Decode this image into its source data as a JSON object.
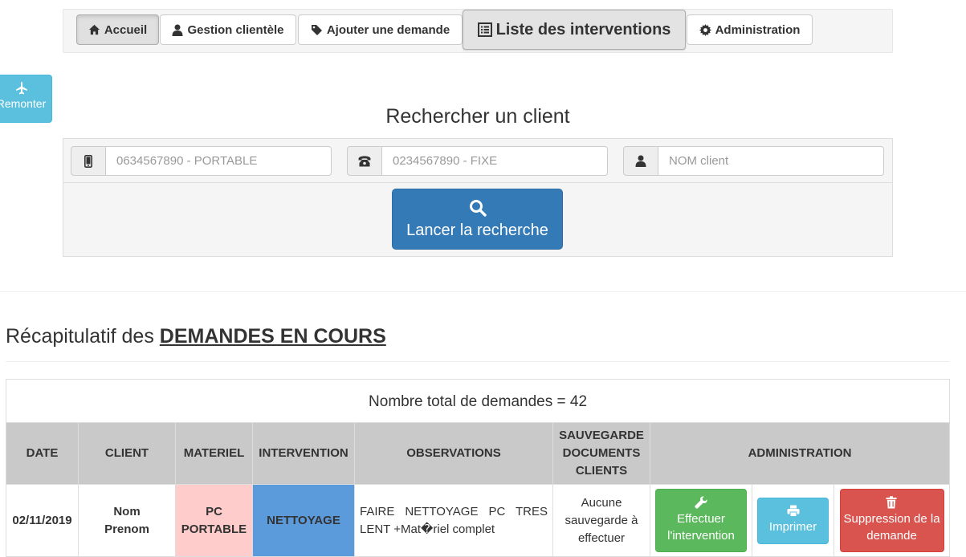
{
  "nav": {
    "items": [
      {
        "label": "Accueil",
        "icon": "home-icon"
      },
      {
        "label": "Gestion clientèle",
        "icon": "user-icon"
      },
      {
        "label": "Ajouter une demande",
        "icon": "tag-icon"
      },
      {
        "label": "Liste des interventions",
        "icon": "list-icon"
      },
      {
        "label": "Administration",
        "icon": "gear-icon"
      }
    ]
  },
  "remonter": {
    "label": "Remonter",
    "icon": "plane-icon"
  },
  "search": {
    "title": "Rechercher un client",
    "mobile_placeholder": "0634567890 - PORTABLE",
    "phone_placeholder": "0234567890 - FIXE",
    "name_placeholder": "NOM client",
    "button_label": "Lancer la recherche"
  },
  "recap": {
    "title_prefix": "Récapitulatif des ",
    "title_emphasis": "DEMANDES EN COURS"
  },
  "table": {
    "total_label": "Nombre total de demandes = 42",
    "headers": {
      "date": "DATE",
      "client": "CLIENT",
      "materiel": "MATERIEL",
      "intervention": "INTERVENTION",
      "observations": "OBSERVATIONS",
      "sauvegarde": "SAUVEGARDE DOCUMENTS CLIENTS",
      "administration": "ADMINISTRATION"
    },
    "rows": [
      {
        "date": "02/11/2019",
        "client": "Nom Prenom",
        "materiel": "PC PORTABLE",
        "intervention": "NETTOYAGE",
        "observations": "FAIRE NETTOYAGE PC TRES LENT +Mat�riel complet",
        "sauvegarde": "Aucune sauvegarde à effectuer",
        "actions": {
          "effectuer": "Effectuer l'intervention",
          "imprimer": "Imprimer",
          "suppression": "Suppression de la demande"
        }
      }
    ]
  },
  "colors": {
    "primary": "#337ab7",
    "info": "#5bc0de",
    "success": "#5cb85c",
    "danger": "#d9534f",
    "materiel_bg": "#ffcccc",
    "intervention_bg": "#5b9bdc",
    "header_bg": "#c9c9c9"
  }
}
